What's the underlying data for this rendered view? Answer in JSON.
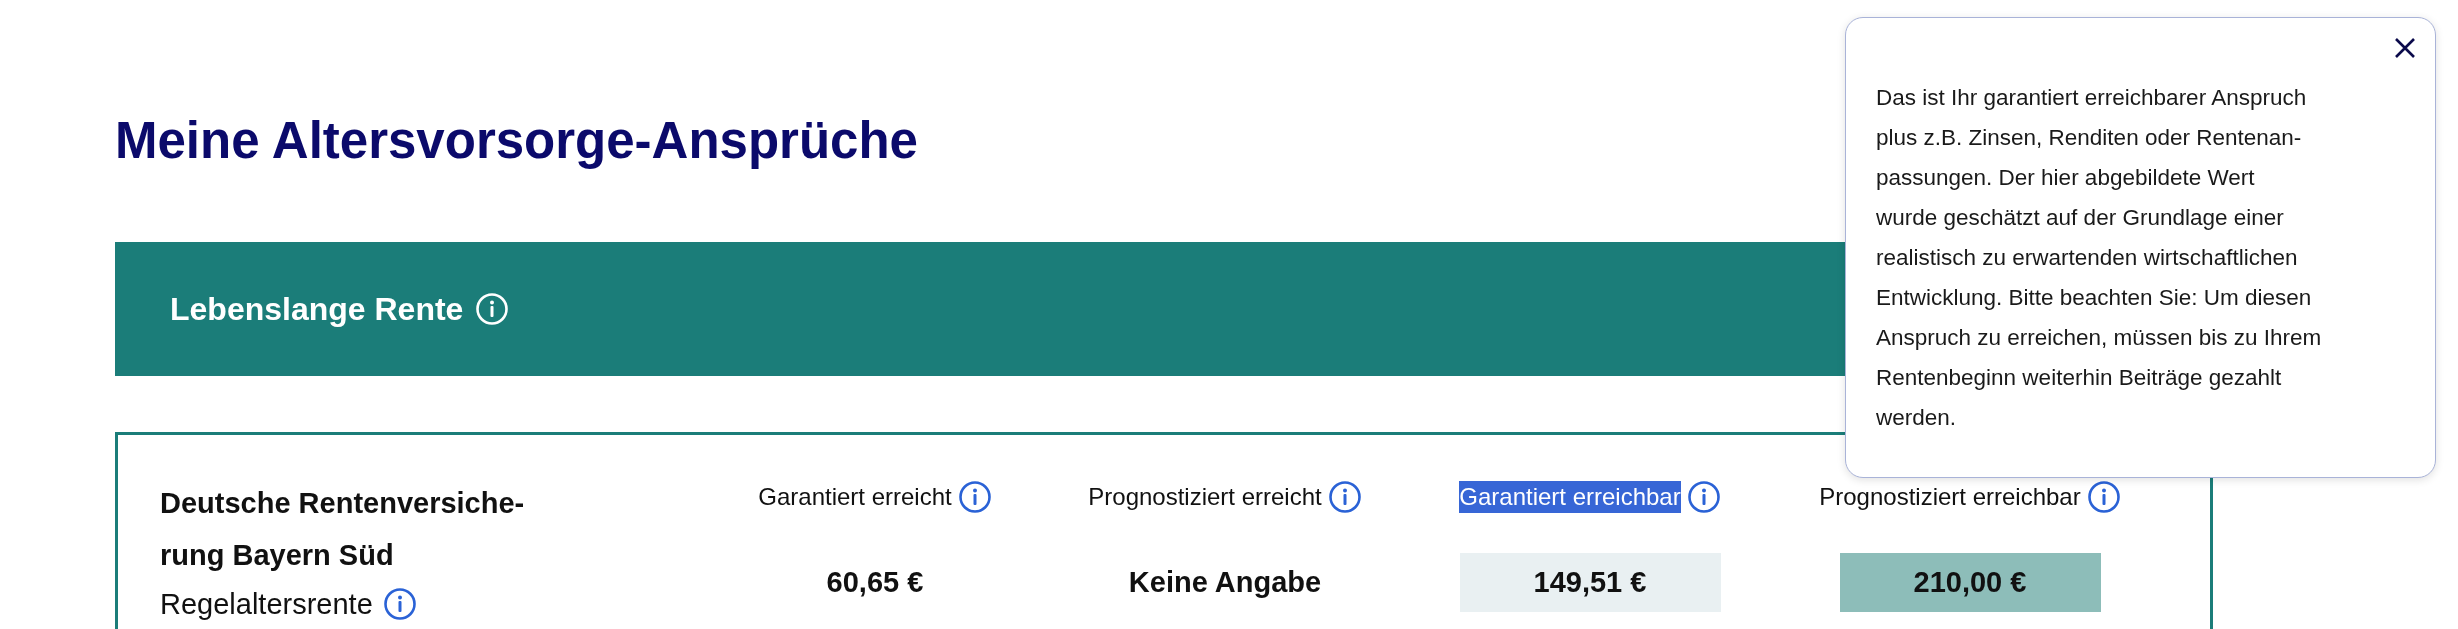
{
  "page_title": "Meine Altersvorsorge-Ansprüche",
  "section": {
    "title": "Lebenslange Rente"
  },
  "provider": {
    "name": "Deutsche Rentenversiche-\nrung Bayern Süd",
    "type": "Regelaltersrente"
  },
  "columns": [
    {
      "label": "Garantiert erreicht",
      "highlighted": false,
      "value": "60,65 €",
      "kind": "plain"
    },
    {
      "label": "Prognostiziert erreicht",
      "highlighted": false,
      "value": "Keine Angabe",
      "kind": "plain"
    },
    {
      "label": "Garantiert erreichbar",
      "highlighted": true,
      "value": "149,51 €",
      "kind": "light"
    },
    {
      "label": "Prognostiziert erreichbar",
      "highlighted": false,
      "value": "210,00 €",
      "kind": "teal"
    }
  ],
  "tooltip": {
    "text": "Das ist Ihr garantiert erreichbarer Anspruch\nplus z.B. Zinsen, Renditen oder Rentenan-\npassungen. Der hier abgebildete Wert\nwurde geschätzt auf der Grundlage einer\nrealistisch zu erwartenden wirtschaftlichen\nEntwicklung. Bitte beachten Sie: Um diesen\nAnspruch zu erreichen, müssen bis zu Ihrem\nRentenbeginn weiterhin Beiträge gezahlt\nwerden."
  }
}
